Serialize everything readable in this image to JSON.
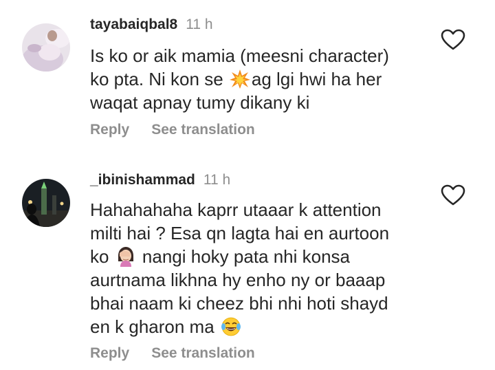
{
  "comments": [
    {
      "username": "tayabaiqbal8",
      "time": "11 h",
      "lines": [
        [
          "Is ko or aik mamia (meesni character)"
        ],
        [
          "ko pta. Ni kon se ",
          "ag lgi hwi ha her"
        ],
        [
          "waqat apnay tumy dikany ki"
        ]
      ],
      "emoji": "collision-emoji",
      "reply_label": "Reply",
      "translate_label": "See translation",
      "like_icon": "heart-outline-icon"
    },
    {
      "username": "_ibinishammad",
      "time": "11 h",
      "lines": [
        [
          "Hahahahaha kaprr utaaar k attention"
        ],
        [
          "milti hai ? Esa qn lagta hai en aurtoon"
        ],
        [
          "ko ",
          " nangi hoky pata nhi konsa"
        ],
        [
          "aurtnama likhna hy enho ny or baaap"
        ],
        [
          "bhai naam ki cheez bhi nhi hoti shayd"
        ],
        [
          "en k gharon ma "
        ]
      ],
      "emojis": [
        "woman-facepalming-emoji",
        "face-with-tears-of-joy-emoji"
      ],
      "reply_label": "Reply",
      "translate_label": "See translation",
      "like_icon": "heart-outline-icon"
    }
  ],
  "colors": {
    "text_primary": "#262626",
    "text_secondary": "#8e8e8e",
    "background": "#ffffff"
  }
}
